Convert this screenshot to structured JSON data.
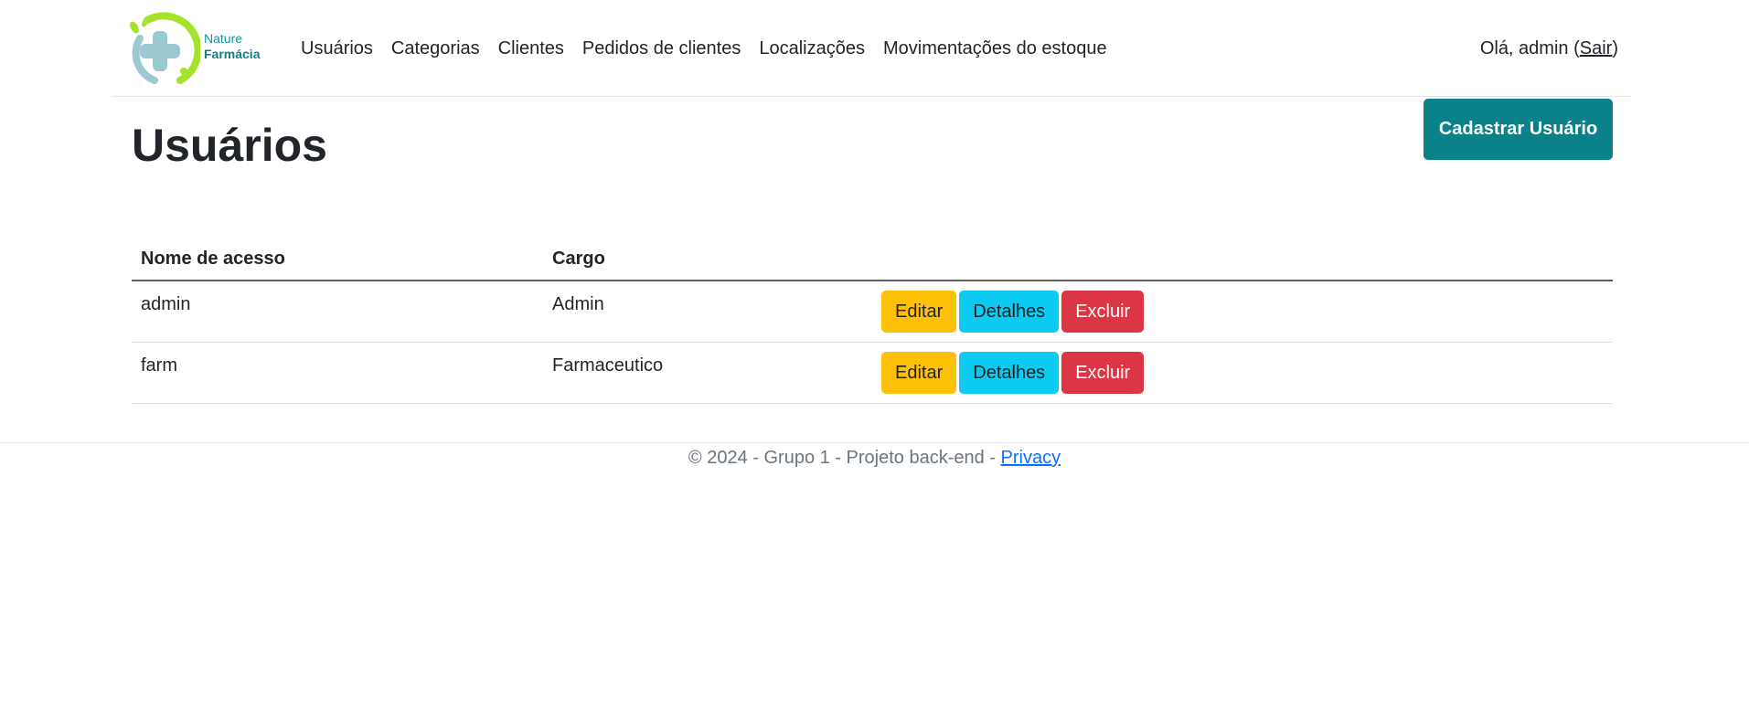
{
  "brand": {
    "line1": "Nature",
    "line2": "Farmácia"
  },
  "nav": {
    "items": [
      {
        "label": "Usuários"
      },
      {
        "label": "Categorias"
      },
      {
        "label": "Clientes"
      },
      {
        "label": "Pedidos de clientes"
      },
      {
        "label": "Localizações"
      },
      {
        "label": "Movimentações do estoque"
      }
    ],
    "greeting_prefix": "Olá, admin (",
    "logout_label": "Sair",
    "greeting_suffix": ")"
  },
  "page": {
    "title": "Usuários",
    "create_button": "Cadastrar Usuário"
  },
  "table": {
    "columns": [
      "Nome de acesso",
      "Cargo"
    ],
    "rows": [
      {
        "login": "admin",
        "cargo": "Admin"
      },
      {
        "login": "farm",
        "cargo": "Farmaceutico"
      }
    ],
    "actions": {
      "edit": "Editar",
      "details": "Detalhes",
      "delete": "Excluir"
    }
  },
  "footer": {
    "text": "© 2024 - Grupo 1 - Projeto back-end - ",
    "privacy_label": "Privacy"
  },
  "colors": {
    "primary_teal": "#0b8189",
    "warning": "#ffc107",
    "info": "#0dcaf0",
    "danger": "#dc3545",
    "logo_green": "#a5e22b",
    "logo_blue": "#9cc8d2"
  },
  "icons": {
    "logo": "pharmacy-cross-logo-icon"
  }
}
